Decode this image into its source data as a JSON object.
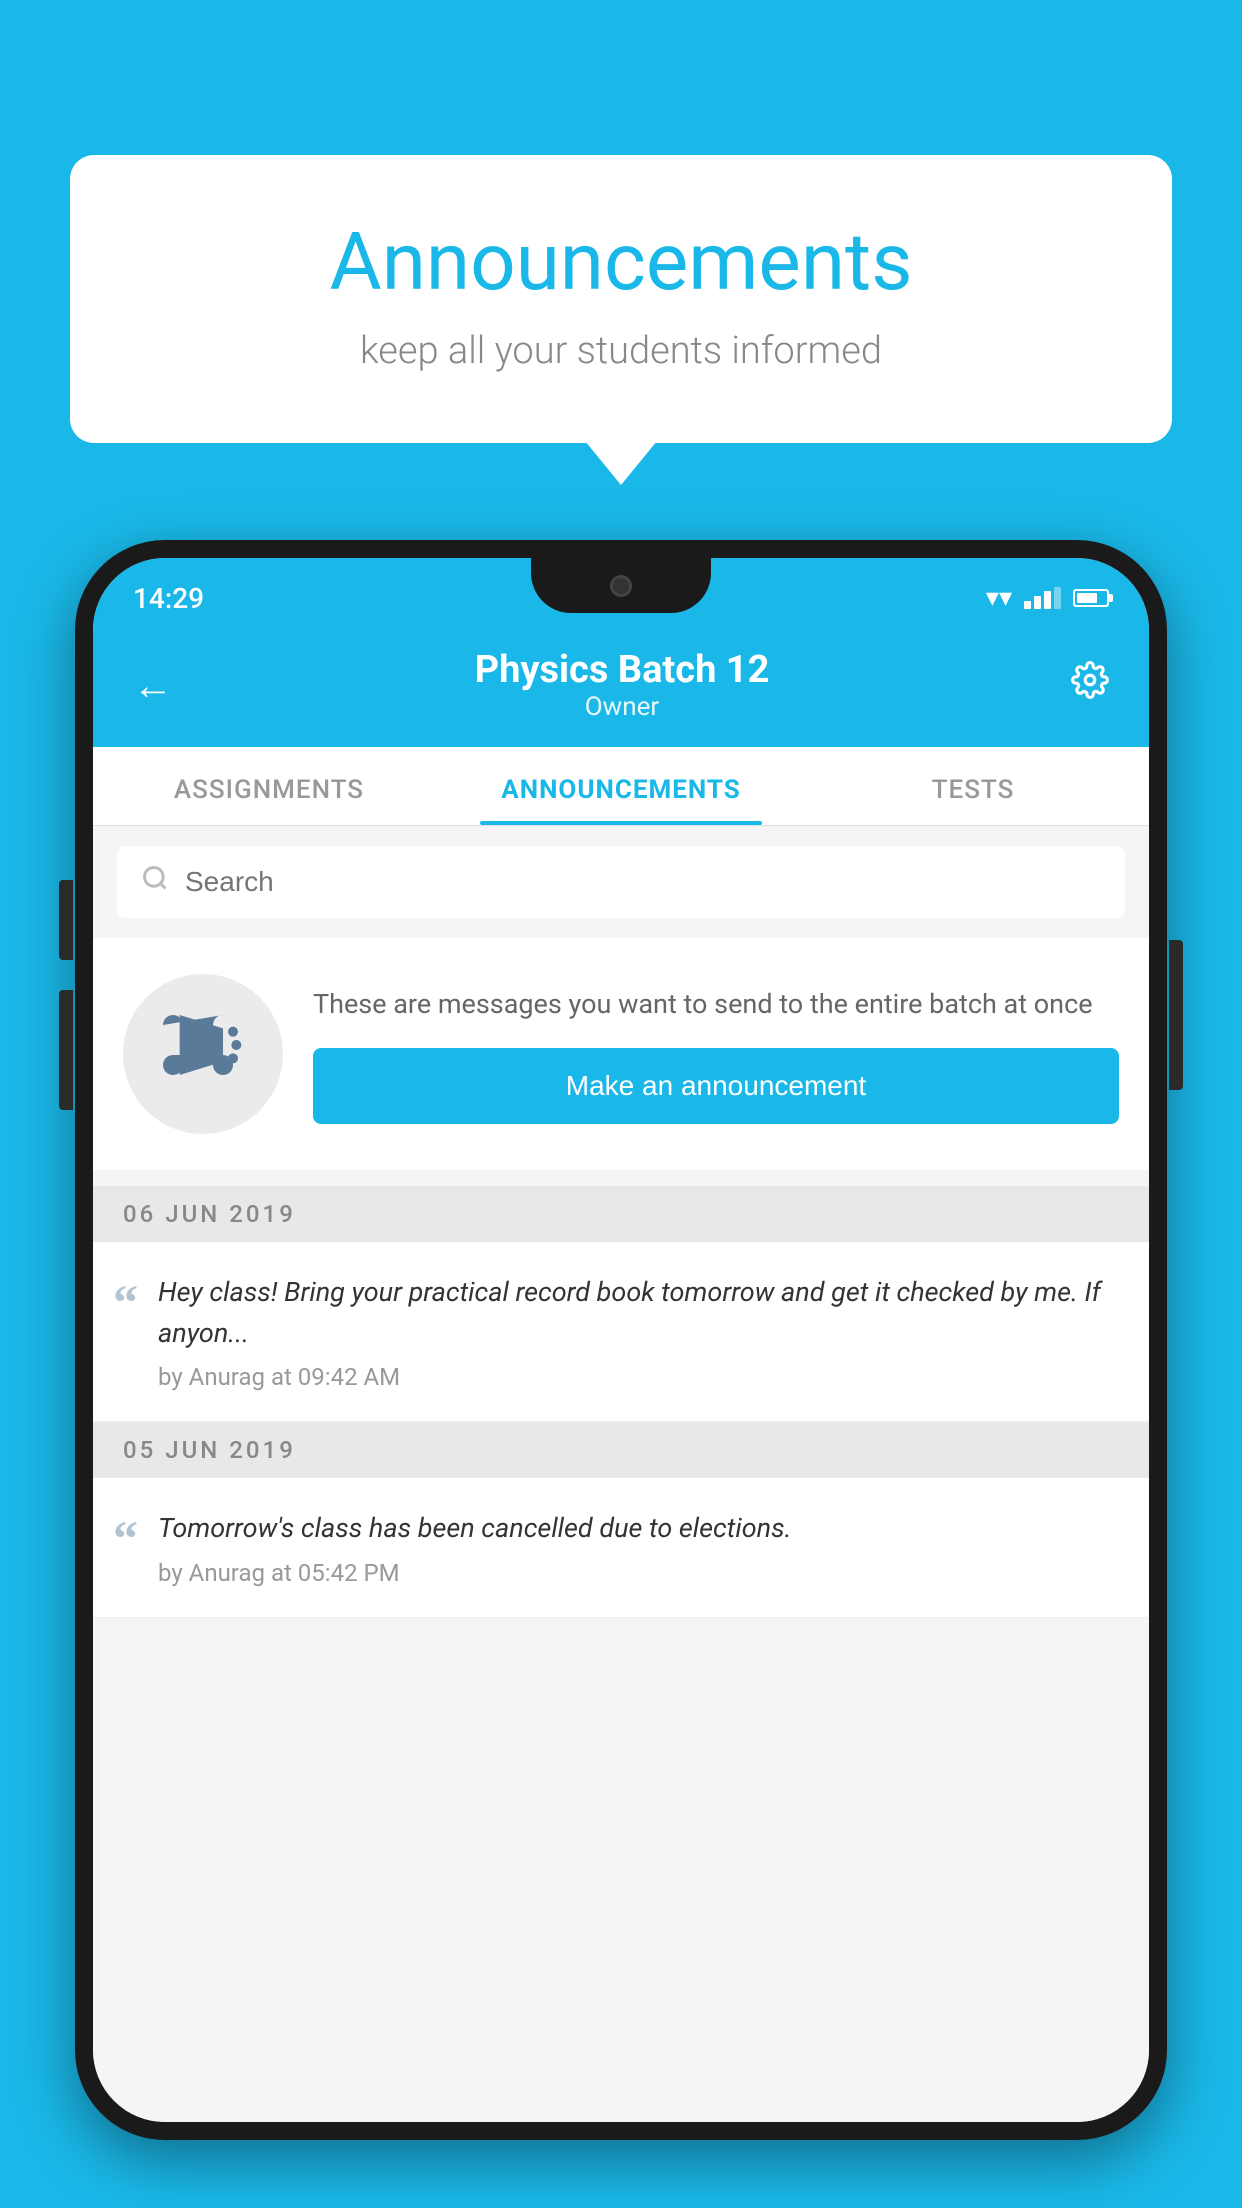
{
  "bubble": {
    "title": "Announcements",
    "subtitle": "keep all your students informed"
  },
  "status_bar": {
    "time": "14:29",
    "wifi": "▾",
    "battery_level": "70"
  },
  "header": {
    "title": "Physics Batch 12",
    "subtitle": "Owner",
    "back_label": "←",
    "gear_label": "⚙"
  },
  "tabs": [
    {
      "label": "ASSIGNMENTS",
      "active": false
    },
    {
      "label": "ANNOUNCEMENTS",
      "active": true
    },
    {
      "label": "TESTS",
      "active": false
    }
  ],
  "search": {
    "placeholder": "Search"
  },
  "promo": {
    "description": "These are messages you want to send to the entire batch at once",
    "button_label": "Make an announcement"
  },
  "dates": [
    {
      "label": "06  JUN  2019",
      "announcements": [
        {
          "text": "Hey class! Bring your practical record book tomorrow and get it checked by me. If anyon...",
          "meta": "by Anurag at 09:42 AM"
        }
      ]
    },
    {
      "label": "05  JUN  2019",
      "announcements": [
        {
          "text": "Tomorrow's class has been cancelled due to elections.",
          "meta": "by Anurag at 05:42 PM"
        }
      ]
    }
  ]
}
